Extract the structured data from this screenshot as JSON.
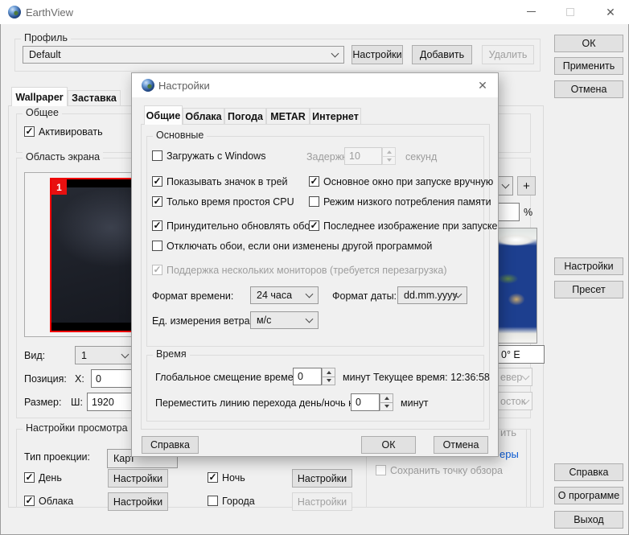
{
  "window": {
    "title": "EarthView"
  },
  "profile": {
    "label": "Профиль",
    "value": "Default",
    "settings": "Настройки",
    "add": "Добавить",
    "remove": "Удалить"
  },
  "right_buttons": {
    "ok": "ОК",
    "apply": "Применить",
    "cancel": "Отмена",
    "settings": "Настройки",
    "preset": "Пресет",
    "help": "Справка",
    "about": "О программе",
    "exit": "Выход"
  },
  "tabs": {
    "wallpaper": "Wallpaper",
    "screensaver": "Заставка"
  },
  "general_group": {
    "title": "Общее",
    "activate": "Активировать"
  },
  "screen_area": {
    "title": "Область экрана",
    "badge": "1",
    "view_label": "Вид:",
    "view_value": "1",
    "position_label": "Позиция:",
    "x_label": "X:",
    "x_value": "0",
    "size_label": "Размер:",
    "w_label": "Ш:",
    "w_value": "1920"
  },
  "view_settings": {
    "title": "Настройки просмотра",
    "projection_label": "Тип проекции:",
    "projection_value": "Карт",
    "day": "День",
    "clouds": "Облака",
    "night": "Ночь",
    "cities": "Города",
    "settings": "Настройки"
  },
  "right_fragments": {
    "plus": "+",
    "percent": "%",
    "coord": "0° E",
    "north": "евер",
    "east": "осток",
    "btn_fragment": "ить",
    "link_fragment": "еры",
    "save_viewpoint": "Сохранить точку обзора"
  },
  "dialog": {
    "title": "Настройки",
    "tabs": [
      "Общие",
      "Облака",
      "Погода",
      "METAR",
      "Интернет"
    ],
    "main_group": {
      "title": "Основные",
      "load_windows": "Загружать с Windows",
      "delay_label": "Задержка:",
      "delay_value": "10",
      "seconds": "секунд",
      "tray": "Показывать значок в трей",
      "main_window_manual": "Основное окно при запуске вручную",
      "cpu_idle": "Только время простоя CPU",
      "low_memory": "Режим низкого потребления памяти",
      "force_update": "Принудительно обновлять обои",
      "last_image": "Последнее изображение при запуске",
      "disable_changed": "Отключать обои, если они изменены другой программой",
      "multimonitor": "Поддержка нескольких мониторов (требуется перезагрузка)",
      "time_format_label": "Формат времени:",
      "time_format_value": "24 часа",
      "date_format_label": "Формат даты:",
      "date_format_value": "dd.mm.yyyy",
      "wind_label": "Ед. измерения ветра:",
      "wind_value": "м/с"
    },
    "time_group": {
      "title": "Время",
      "offset_label": "Глобальное смещение времени:",
      "offset_value": "0",
      "minutes": "минут",
      "current_time": "Текущее время: 12:36:58",
      "terminator_label": "Переместить линию перехода день/ночь на:",
      "terminator_value": "0",
      "minutes2": "минут"
    },
    "buttons": {
      "help": "Справка",
      "ok": "ОК",
      "cancel": "Отмена"
    }
  }
}
